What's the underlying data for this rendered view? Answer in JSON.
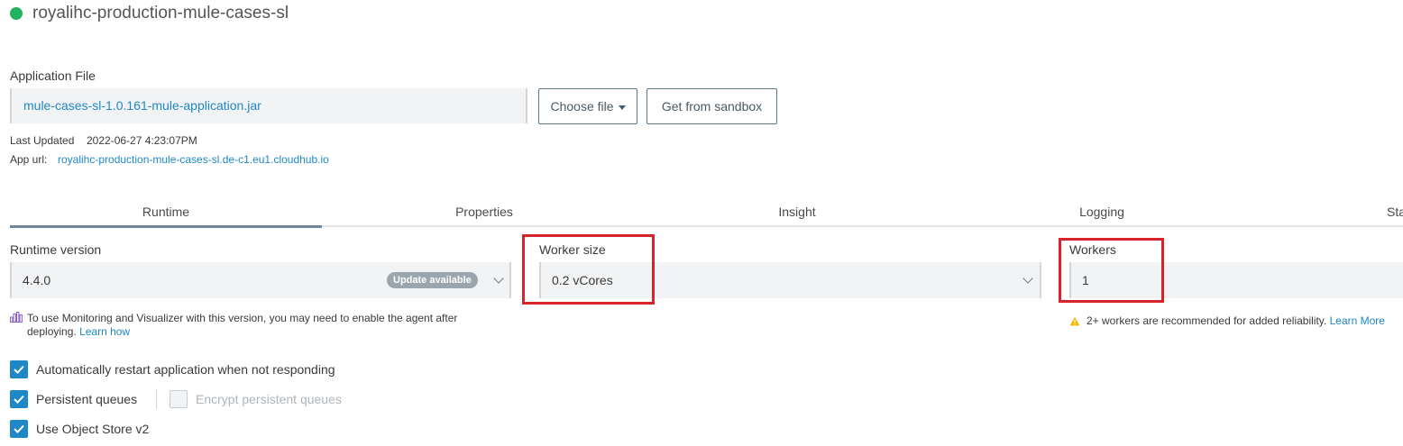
{
  "app": {
    "name": "royalihc-production-mule-cases-sl",
    "status_color": "#22b35e"
  },
  "application_file": {
    "label": "Application File",
    "file_name": "mule-cases-sl-1.0.161-mule-application.jar",
    "choose_file_label": "Choose file",
    "sandbox_label": "Get from sandbox",
    "last_updated_label": "Last Updated",
    "last_updated_value": "2022-06-27 4:23:07PM",
    "app_url_label": "App url:",
    "app_url_value": "royalihc-production-mule-cases-sl.de-c1.eu1.cloudhub.io"
  },
  "tabs": [
    {
      "label": "Runtime",
      "active": true
    },
    {
      "label": "Properties",
      "active": false
    },
    {
      "label": "Insight",
      "active": false
    },
    {
      "label": "Logging",
      "active": false
    },
    {
      "label": "Sta",
      "active": false
    }
  ],
  "runtime": {
    "label": "Runtime version",
    "value": "4.4.0",
    "badge": "Update available",
    "note": "To use Monitoring and Visualizer with this version, you may need to enable the agent after deploying.",
    "note_link": "Learn how"
  },
  "worker_size": {
    "label": "Worker size",
    "value": "0.2 vCores"
  },
  "workers": {
    "label": "Workers",
    "value": "1",
    "note": "2+ workers are recommended for added reliability.",
    "note_link": "Learn More"
  },
  "options": {
    "restart": {
      "label": "Automatically restart application when not responding",
      "checked": true
    },
    "persistent_queues": {
      "label": "Persistent queues",
      "checked": true
    },
    "encrypt_queues": {
      "label": "Encrypt persistent queues",
      "checked": false
    },
    "object_store": {
      "label": "Use Object Store v2",
      "checked": true
    }
  },
  "colors": {
    "accent": "#1e88c7",
    "highlight": "#d8232a"
  }
}
